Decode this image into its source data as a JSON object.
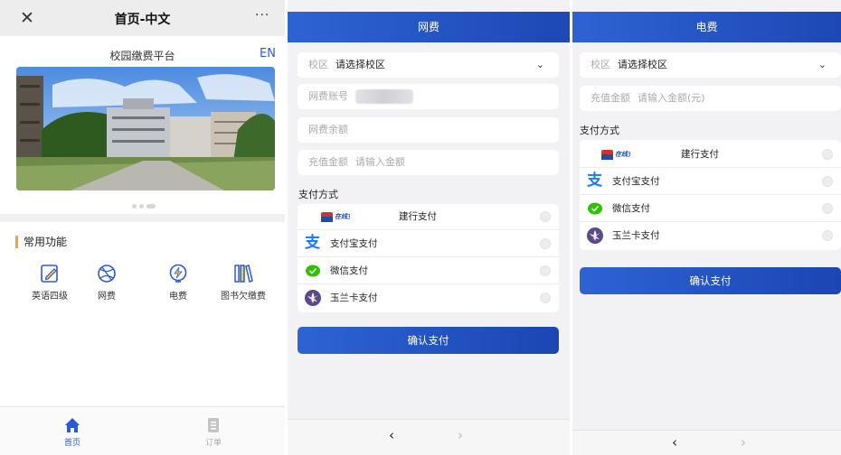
{
  "home": {
    "close_icon": "close-icon",
    "title": "首页-中文",
    "more": "···",
    "subtitle": "校园缴费平台",
    "lang": "EN",
    "section": "常用功能",
    "functions": [
      {
        "label": "英语四级",
        "icon": "pencil-note-icon"
      },
      {
        "label": "网费",
        "icon": "globe-icon"
      },
      {
        "label": "电费",
        "icon": "lightning-icon"
      },
      {
        "label": "图书欠缴费",
        "icon": "books-icon"
      }
    ],
    "tabs": [
      {
        "label": "首页",
        "icon": "home-icon",
        "active": true
      },
      {
        "label": "订单",
        "icon": "order-icon",
        "active": false
      }
    ]
  },
  "net": {
    "header": "网费",
    "campus_label": "校区",
    "campus_value": "请选择校区",
    "account_label": "网费账号",
    "balance_label": "网费余额",
    "amount_label": "充值金额",
    "amount_placeholder": "请输入金额",
    "pay_method_label": "支付方式",
    "methods": [
      {
        "label": "建行支付",
        "logo_text": "在线支付"
      },
      {
        "label": "支付宝支付"
      },
      {
        "label": "微信支付"
      },
      {
        "label": "玉兰卡支付"
      }
    ],
    "confirm": "确认支付",
    "back": "‹",
    "forward": "›"
  },
  "elec": {
    "header": "电费",
    "campus_label": "校区",
    "campus_value": "请选择校区",
    "amount_label": "充值金额",
    "amount_placeholder": "请输入金额(元)",
    "pay_method_label": "支付方式",
    "methods": [
      {
        "label": "建行支付",
        "logo_text": "在线支付"
      },
      {
        "label": "支付宝支付"
      },
      {
        "label": "微信支付"
      },
      {
        "label": "玉兰卡支付"
      }
    ],
    "confirm": "确认支付",
    "back": "‹",
    "forward": "›"
  },
  "colors": {
    "accent": "#2a5bd7",
    "section_bar": "#f2a03d",
    "wechat": "#2dc100",
    "alipay": "#1677ff"
  }
}
